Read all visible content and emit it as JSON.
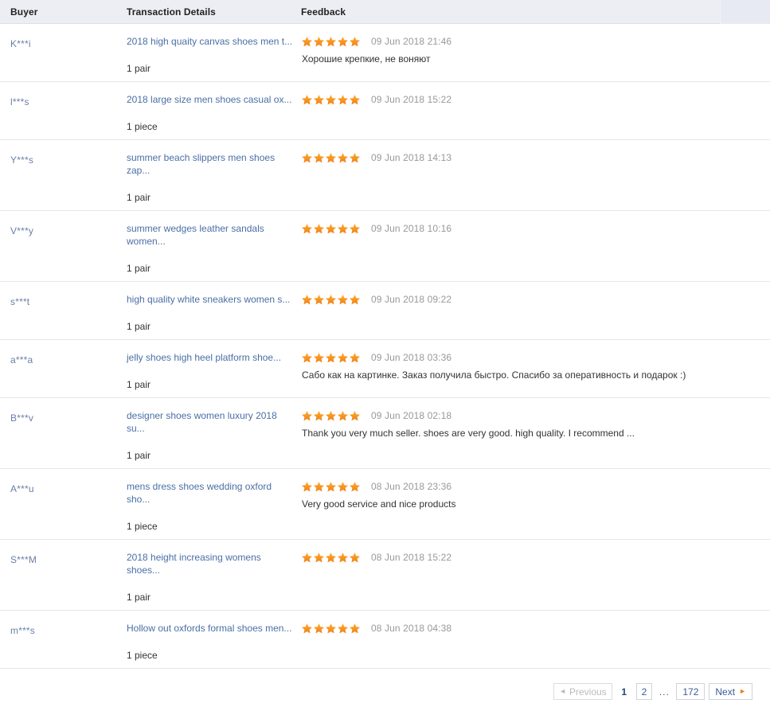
{
  "table": {
    "columns": [
      "Buyer",
      "Transaction Details",
      "Feedback"
    ],
    "rows": [
      {
        "buyer": "K***i",
        "item": "2018 high quaity canvas shoes men t...",
        "quantity": "1 pair",
        "rating": 5,
        "date": "09 Jun 2018 21:46",
        "comment": "Хорошие крепкие, не воняют"
      },
      {
        "buyer": "l***s",
        "item": "2018 large size men shoes casual ox...",
        "quantity": "1 piece",
        "rating": 5,
        "date": "09 Jun 2018 15:22",
        "comment": ""
      },
      {
        "buyer": "Y***s",
        "item": "summer beach slippers men shoes zap...",
        "quantity": "1 pair",
        "rating": 5,
        "date": "09 Jun 2018 14:13",
        "comment": ""
      },
      {
        "buyer": "V***y",
        "item": "summer wedges leather sandals women...",
        "quantity": "1 pair",
        "rating": 5,
        "date": "09 Jun 2018 10:16",
        "comment": ""
      },
      {
        "buyer": "s***t",
        "item": "high quality white sneakers women s...",
        "quantity": "1 pair",
        "rating": 5,
        "date": "09 Jun 2018 09:22",
        "comment": ""
      },
      {
        "buyer": "a***a",
        "item": "jelly shoes high heel platform shoe...",
        "quantity": "1 pair",
        "rating": 5,
        "date": "09 Jun 2018 03:36",
        "comment": "Сабо как на картинке. Заказ получила быстро. Спасибо за оперативность и подарок :)"
      },
      {
        "buyer": "B***v",
        "item": "designer shoes women luxury 2018 su...",
        "quantity": "1 pair",
        "rating": 5,
        "date": "09 Jun 2018 02:18",
        "comment": "Thank you very much seller. shoes are very good. high quality. I recommend ..."
      },
      {
        "buyer": "A***u",
        "item": "mens dress shoes wedding oxford sho...",
        "quantity": "1 piece",
        "rating": 5,
        "date": "08 Jun 2018 23:36",
        "comment": "Very good service and nice products"
      },
      {
        "buyer": "S***M",
        "item": "2018 height increasing womens shoes...",
        "quantity": "1 pair",
        "rating": 5,
        "date": "08 Jun 2018 15:22",
        "comment": ""
      },
      {
        "buyer": "m***s",
        "item": "Hollow out oxfords formal shoes men...",
        "quantity": "1 piece",
        "rating": 5,
        "date": "08 Jun 2018 04:38",
        "comment": ""
      }
    ]
  },
  "pagination": {
    "previous_label": "Previous",
    "next_label": "Next",
    "ellipsis": "...",
    "pages": [
      "1",
      "2"
    ],
    "current_page": "1",
    "last_page": "172",
    "previous_enabled": false,
    "next_enabled": true
  },
  "icons": {
    "star": "star-icon",
    "prev_arrow": "◄",
    "next_arrow": "►"
  },
  "colors": {
    "header_bg": "#eceef4",
    "link": "#4a6fa5",
    "buyer": "#6b7fa8",
    "date": "#999999",
    "star": "#f7941e",
    "row_border": "#e6e6e6"
  }
}
